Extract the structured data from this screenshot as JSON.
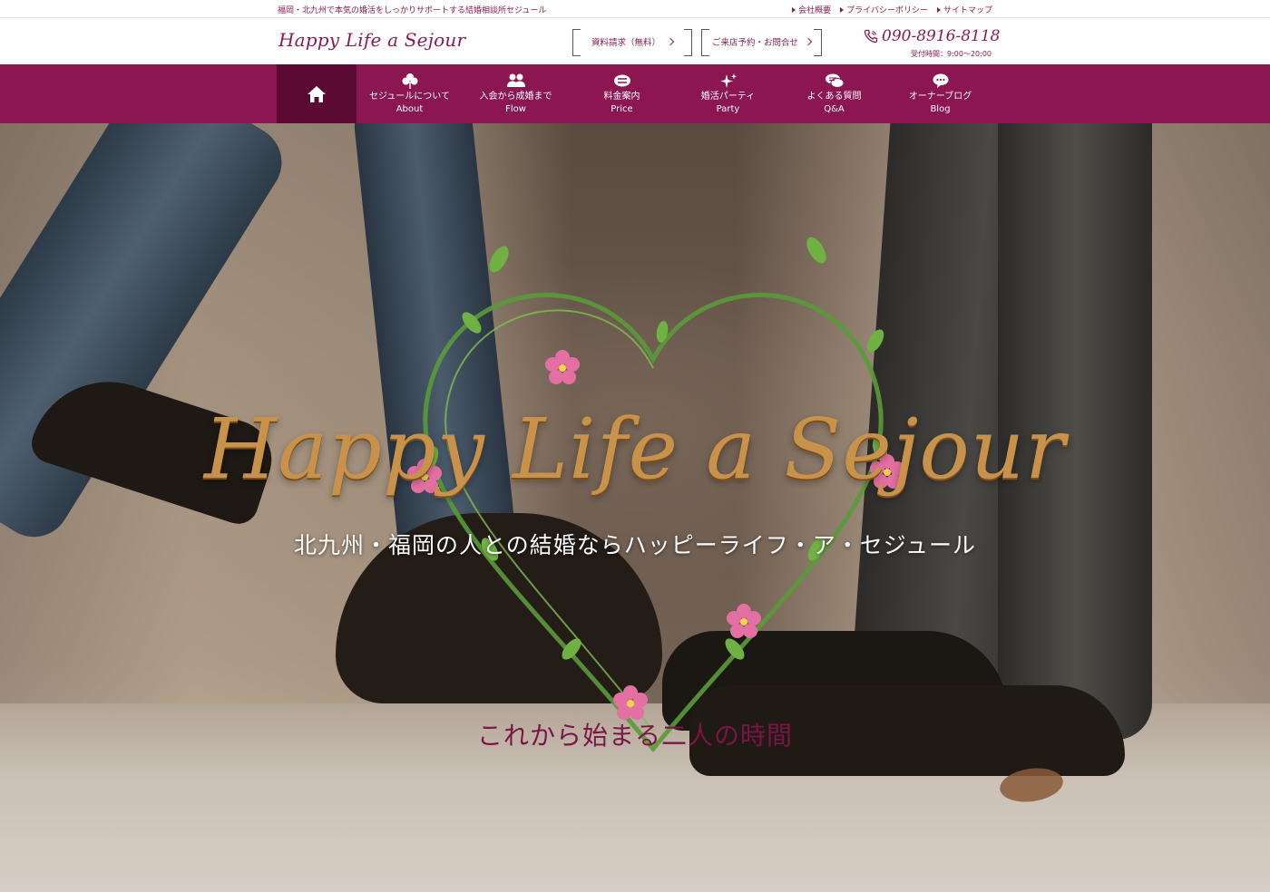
{
  "topbar": {
    "tagline": "福岡・北九州で本気の婚活をしっかりサポートする結婚相談所セジュール",
    "links": [
      "会社概要",
      "プライバシーポリシー",
      "サイトマップ"
    ]
  },
  "header": {
    "logo": "Happy Life a Sejour",
    "buttons": [
      "資料請求（無料）",
      "ご来店予約・お問合せ"
    ],
    "phone": "090-8916-8118",
    "hours": "受付時間：9:00〜20:00"
  },
  "nav": {
    "items": [
      {
        "jp": "セジュールについて",
        "en": "About",
        "icon": "clover-icon"
      },
      {
        "jp": "入会から成婚まで",
        "en": "Flow",
        "icon": "people-icon"
      },
      {
        "jp": "料金案内",
        "en": "Price",
        "icon": "money-icon"
      },
      {
        "jp": "婚活パーティ",
        "en": "Party",
        "icon": "sparkle-icon"
      },
      {
        "jp": "よくある質問",
        "en": "Q&A",
        "icon": "chat-bubbles-icon"
      },
      {
        "jp": "オーナーブログ",
        "en": "Blog",
        "icon": "speech-bubble-icon"
      }
    ]
  },
  "hero": {
    "title": "Happy Life a Sejour",
    "subtitle": "北九州・福岡の人との結婚ならハッピーライフ・ア・セジュール",
    "bottom": "これから始まる二人の時間"
  },
  "colors": {
    "brand": "#8c1652",
    "nav_active": "#5a0a32",
    "gold": "#c9924a"
  }
}
